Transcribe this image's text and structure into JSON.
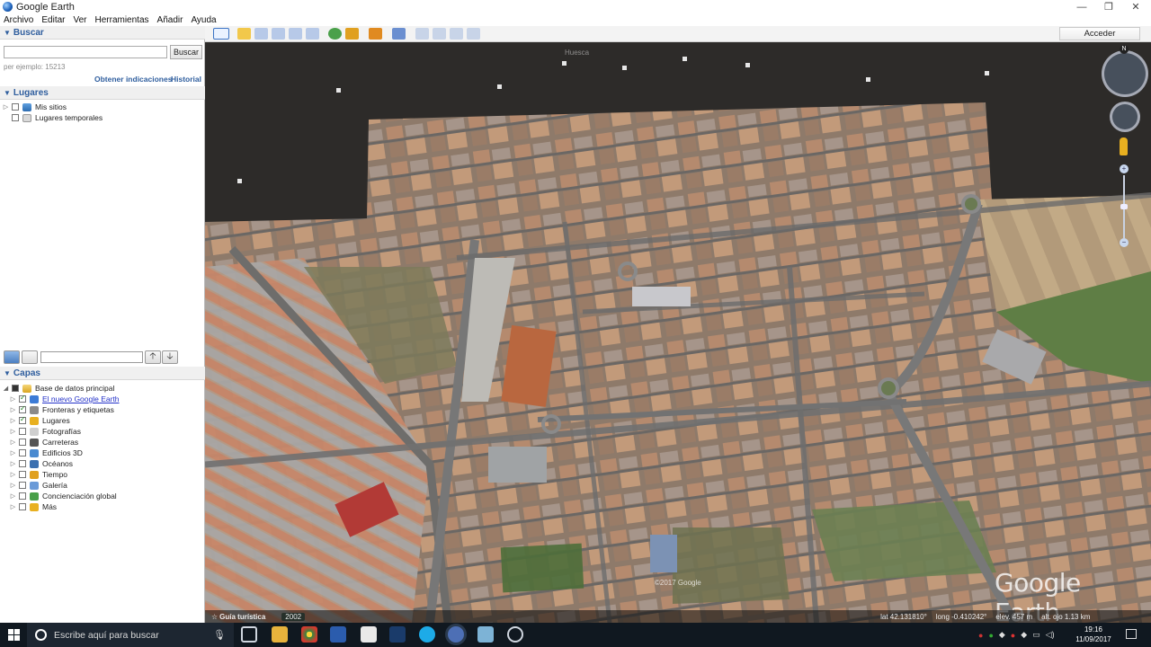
{
  "window": {
    "title": "Google Earth",
    "minimize": "—",
    "maximize": "❐",
    "close": "✕"
  },
  "menu": [
    "Archivo",
    "Editar",
    "Ver",
    "Herramientas",
    "Añadir",
    "Ayuda"
  ],
  "search": {
    "header": "Buscar",
    "button": "Buscar",
    "hint": "per ejemplo: 15213",
    "directions_link": "Obtener indicaciones",
    "history_link": "Historial"
  },
  "places": {
    "header": "Lugares",
    "items": [
      "Mis sitios",
      "Lugares temporales"
    ]
  },
  "layers": {
    "header": "Capas",
    "root": "Base de datos principal",
    "items": [
      {
        "label": "El nuevo Google Earth",
        "checked": true,
        "link": true
      },
      {
        "label": "Fronteras y etiquetas",
        "checked": true
      },
      {
        "label": "Lugares",
        "checked": true
      },
      {
        "label": "Fotografías",
        "checked": false
      },
      {
        "label": "Carreteras",
        "checked": false
      },
      {
        "label": "Edificios 3D",
        "checked": false
      },
      {
        "label": "Océanos",
        "checked": false
      },
      {
        "label": "Tiempo",
        "checked": false
      },
      {
        "label": "Galería",
        "checked": false
      },
      {
        "label": "Concienciación global",
        "checked": false
      },
      {
        "label": "Más",
        "checked": false
      }
    ]
  },
  "toolbar": {
    "acceder": "Acceder"
  },
  "map": {
    "watermark": "Google Earth",
    "copyright": "©2017 Google",
    "north_label": "N",
    "top_label": "Huesca",
    "tour_label": "Guía turística",
    "year": "2002",
    "status": {
      "lat": "lat  42.131810°",
      "lon": "long  -0.410242°",
      "elev": "elev.  457 m",
      "eye": "alt. ojo  1.13 km"
    }
  },
  "taskbar": {
    "search_placeholder": "Escribe aquí para buscar",
    "time": "19:16",
    "date": "11/09/2017"
  },
  "colors": {
    "accent": "#2f5e9e",
    "link": "#2432c9",
    "taskbar": "#101820"
  }
}
